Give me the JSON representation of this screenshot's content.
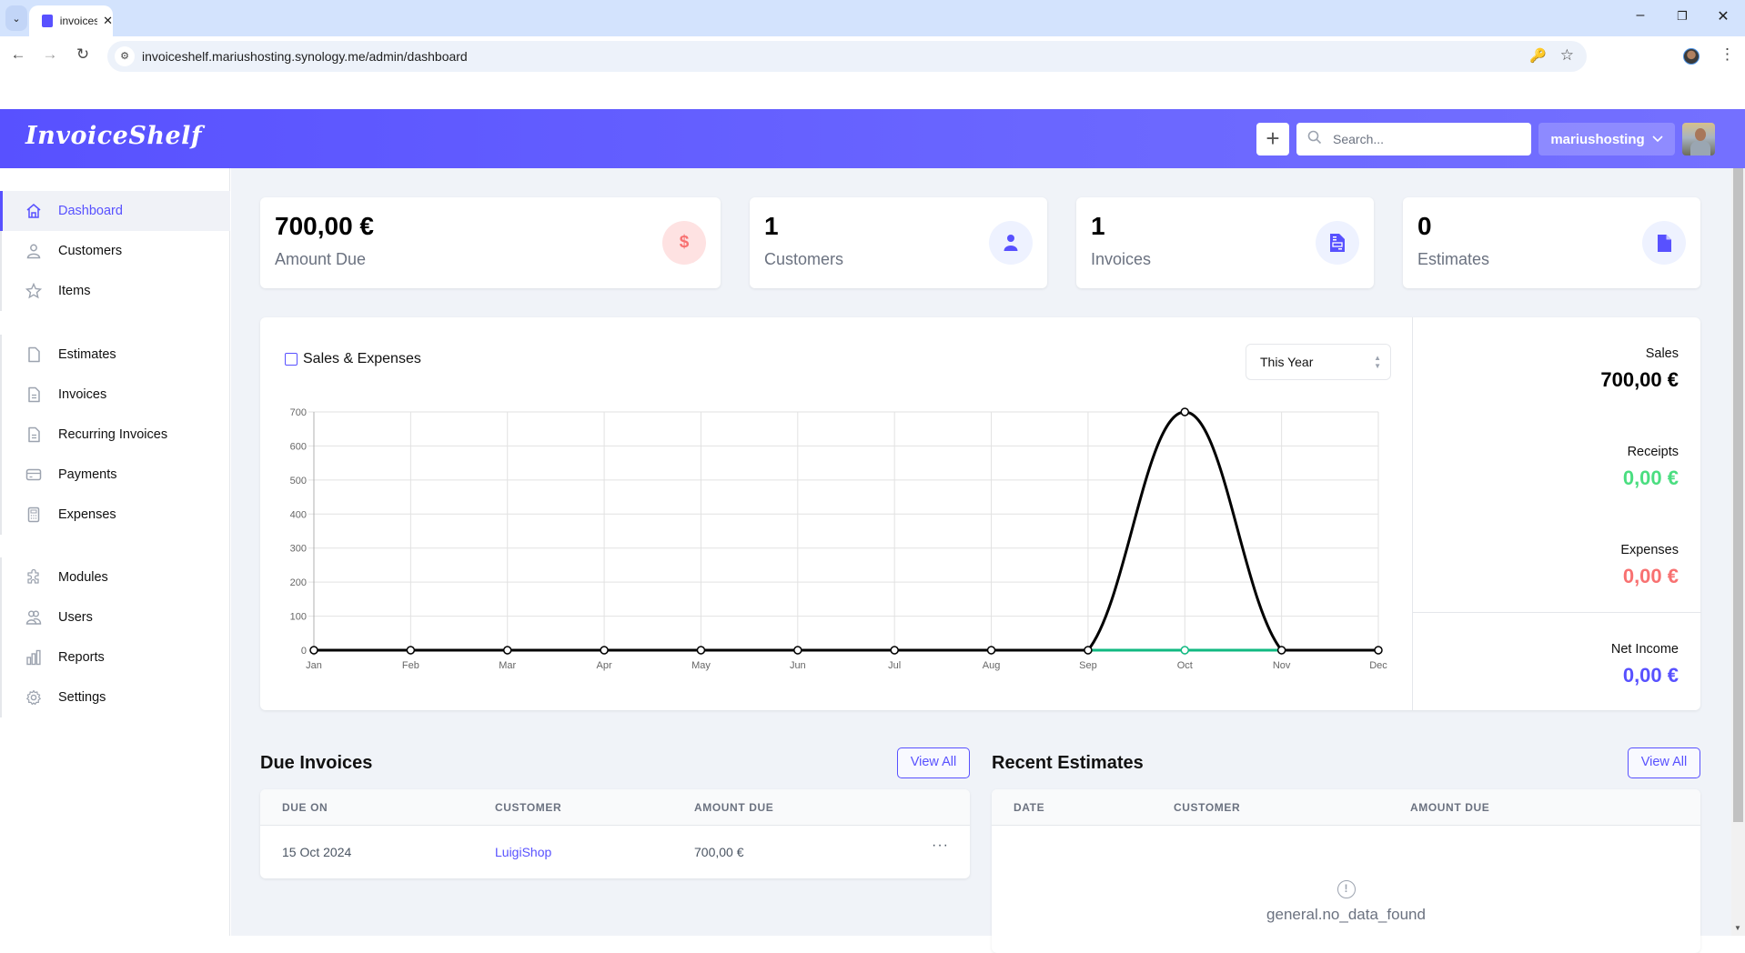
{
  "browser": {
    "tab_title": "invoicesh",
    "url": "invoiceshelf.mariushosting.synology.me/admin/dashboard"
  },
  "header": {
    "logo": "InvoiceShelf",
    "search_placeholder": "Search...",
    "username": "mariushosting"
  },
  "sidebar": {
    "groups": [
      [
        {
          "label": "Dashboard",
          "icon": "home-icon",
          "active": true
        },
        {
          "label": "Customers",
          "icon": "user-icon"
        },
        {
          "label": "Items",
          "icon": "star-icon"
        }
      ],
      [
        {
          "label": "Estimates",
          "icon": "document-icon"
        },
        {
          "label": "Invoices",
          "icon": "document-text-icon"
        },
        {
          "label": "Recurring Invoices",
          "icon": "document-text-icon"
        },
        {
          "label": "Payments",
          "icon": "credit-card-icon"
        },
        {
          "label": "Expenses",
          "icon": "calculator-icon"
        }
      ],
      [
        {
          "label": "Modules",
          "icon": "puzzle-icon"
        },
        {
          "label": "Users",
          "icon": "users-icon"
        },
        {
          "label": "Reports",
          "icon": "chart-bar-icon"
        },
        {
          "label": "Settings",
          "icon": "cog-icon"
        }
      ]
    ]
  },
  "stats": [
    {
      "value": "700,00 €",
      "label": "Amount Due",
      "icon": "dollar-icon"
    },
    {
      "value": "1",
      "label": "Customers",
      "icon": "user-icon"
    },
    {
      "value": "1",
      "label": "Invoices",
      "icon": "invoice-icon"
    },
    {
      "value": "0",
      "label": "Estimates",
      "icon": "document-icon"
    }
  ],
  "chart_section": {
    "title": "Sales & Expenses",
    "period": "This Year"
  },
  "summary": {
    "sales": {
      "label": "Sales",
      "value": "700,00 €"
    },
    "receipts": {
      "label": "Receipts",
      "value": "0,00 €"
    },
    "expenses": {
      "label": "Expenses",
      "value": "0,00 €"
    },
    "net_income": {
      "label": "Net Income",
      "value": "0,00 €"
    }
  },
  "colors": {
    "primary": "#5851ff",
    "sales_line": "#000000",
    "receipts_line": "#10b981",
    "receipts_text": "#4ade80",
    "expenses_text": "#f87171",
    "net_income_text": "#5851ff"
  },
  "chart_data": {
    "type": "line",
    "title": "Sales & Expenses",
    "xlabel": "",
    "ylabel": "",
    "categories": [
      "Jan",
      "Feb",
      "Mar",
      "Apr",
      "May",
      "Jun",
      "Jul",
      "Aug",
      "Sep",
      "Oct",
      "Nov",
      "Dec"
    ],
    "ylim": [
      0,
      700
    ],
    "yticks": [
      0,
      100,
      200,
      300,
      400,
      500,
      600,
      700
    ],
    "grid": true,
    "legend": "none",
    "series": [
      {
        "name": "Sales",
        "color": "#000000",
        "values": [
          0,
          0,
          0,
          0,
          0,
          0,
          0,
          0,
          0,
          700,
          0,
          0
        ]
      },
      {
        "name": "Receipts",
        "color": "#10b981",
        "values": [
          0,
          0,
          0,
          0,
          0,
          0,
          0,
          0,
          0,
          0,
          0,
          0
        ]
      },
      {
        "name": "Expenses",
        "color": "#000000",
        "values": [
          0,
          0,
          0,
          0,
          0,
          0,
          0,
          0,
          0,
          0,
          0,
          0
        ]
      }
    ]
  },
  "due_invoices": {
    "title": "Due Invoices",
    "view_all": "View All",
    "columns": [
      "DUE ON",
      "CUSTOMER",
      "AMOUNT DUE"
    ],
    "rows": [
      {
        "due_on": "15 Oct 2024",
        "customer": "LuigiShop",
        "amount_due": "700,00 €"
      }
    ]
  },
  "recent_estimates": {
    "title": "Recent Estimates",
    "view_all": "View All",
    "columns": [
      "DATE",
      "CUSTOMER",
      "AMOUNT DUE"
    ],
    "empty_message": "general.no_data_found"
  }
}
